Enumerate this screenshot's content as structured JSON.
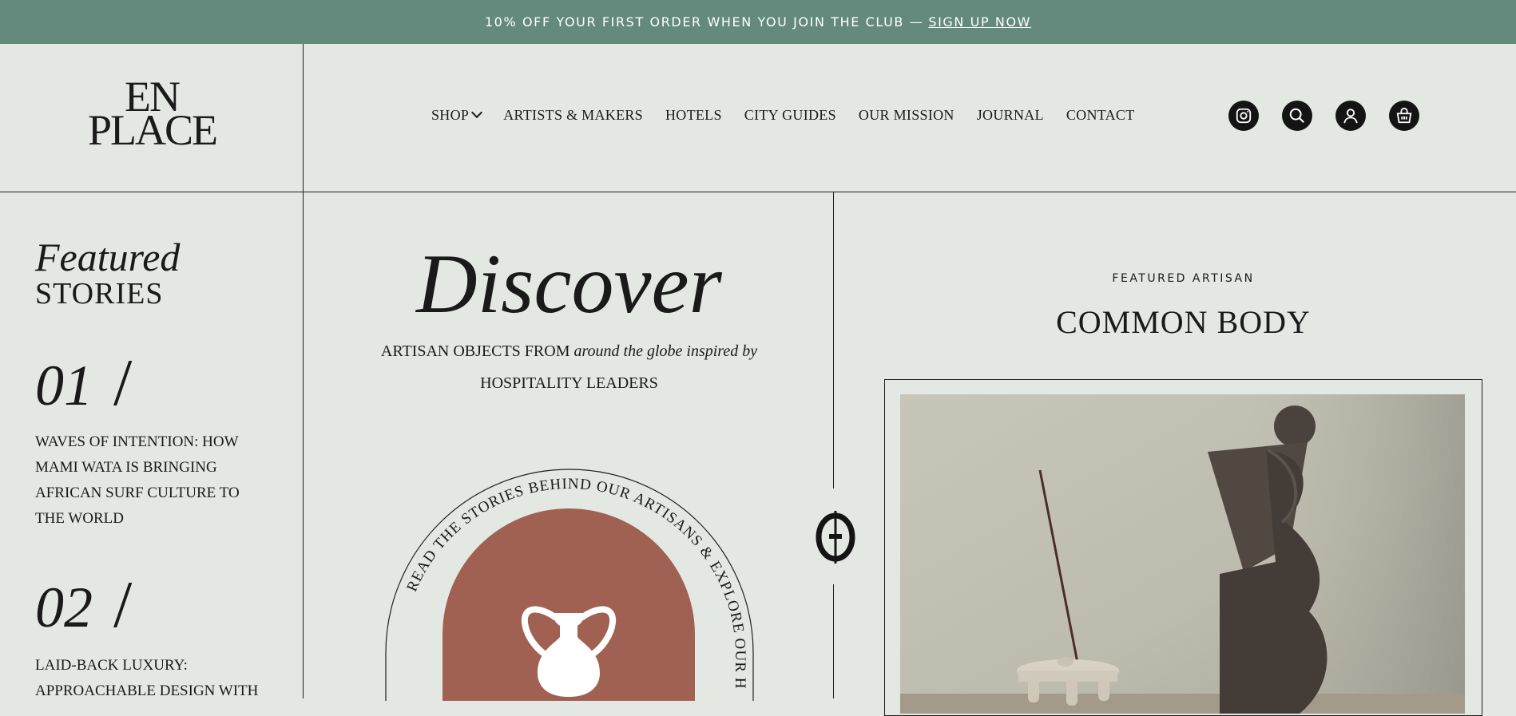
{
  "announcement": {
    "text": "10% OFF YOUR FIRST ORDER WHEN YOU JOIN THE CLUB —",
    "link": "SIGN UP NOW"
  },
  "logo": {
    "line1": "EN",
    "line2": "PLACE"
  },
  "nav": {
    "items": [
      {
        "label": "SHOP"
      },
      {
        "label": "ARTISTS & MAKERS"
      },
      {
        "label": "HOTELS"
      },
      {
        "label": "CITY GUIDES"
      },
      {
        "label": "OUR MISSION"
      },
      {
        "label": "JOURNAL"
      },
      {
        "label": "CONTACT"
      }
    ]
  },
  "header_icons": [
    "instagram-icon",
    "search-icon",
    "account-icon",
    "cart-icon"
  ],
  "sidebar": {
    "featured": "Featured",
    "stories": "STORIES",
    "items": [
      {
        "number": "01",
        "slash": "/",
        "title": "WAVES OF INTENTION: HOW MAMI WATA IS BRINGING AFRICAN SURF CULTURE TO THE WORLD"
      },
      {
        "number": "02",
        "slash": "/",
        "title": "LAID-BACK LUXURY: APPROACHABLE DESIGN WITH"
      }
    ]
  },
  "hero": {
    "title": "Discover",
    "tagline_start": "ARTISAN OBJECTS FROM ",
    "tagline_italic": "around the globe inspired by",
    "tagline_end": "HOSPITALITY LEADERS",
    "arc_text": "READ THE STORIES BEHIND OUR ARTISANS & EXPLORE OUR HOTELS"
  },
  "featured_artisan": {
    "label": "FEATURED ARTISAN",
    "name": "COMMON BODY"
  },
  "colors": {
    "banner": "#638a7c",
    "background": "#e3e9e2",
    "terracotta": "#a06052",
    "ink": "#141414"
  }
}
